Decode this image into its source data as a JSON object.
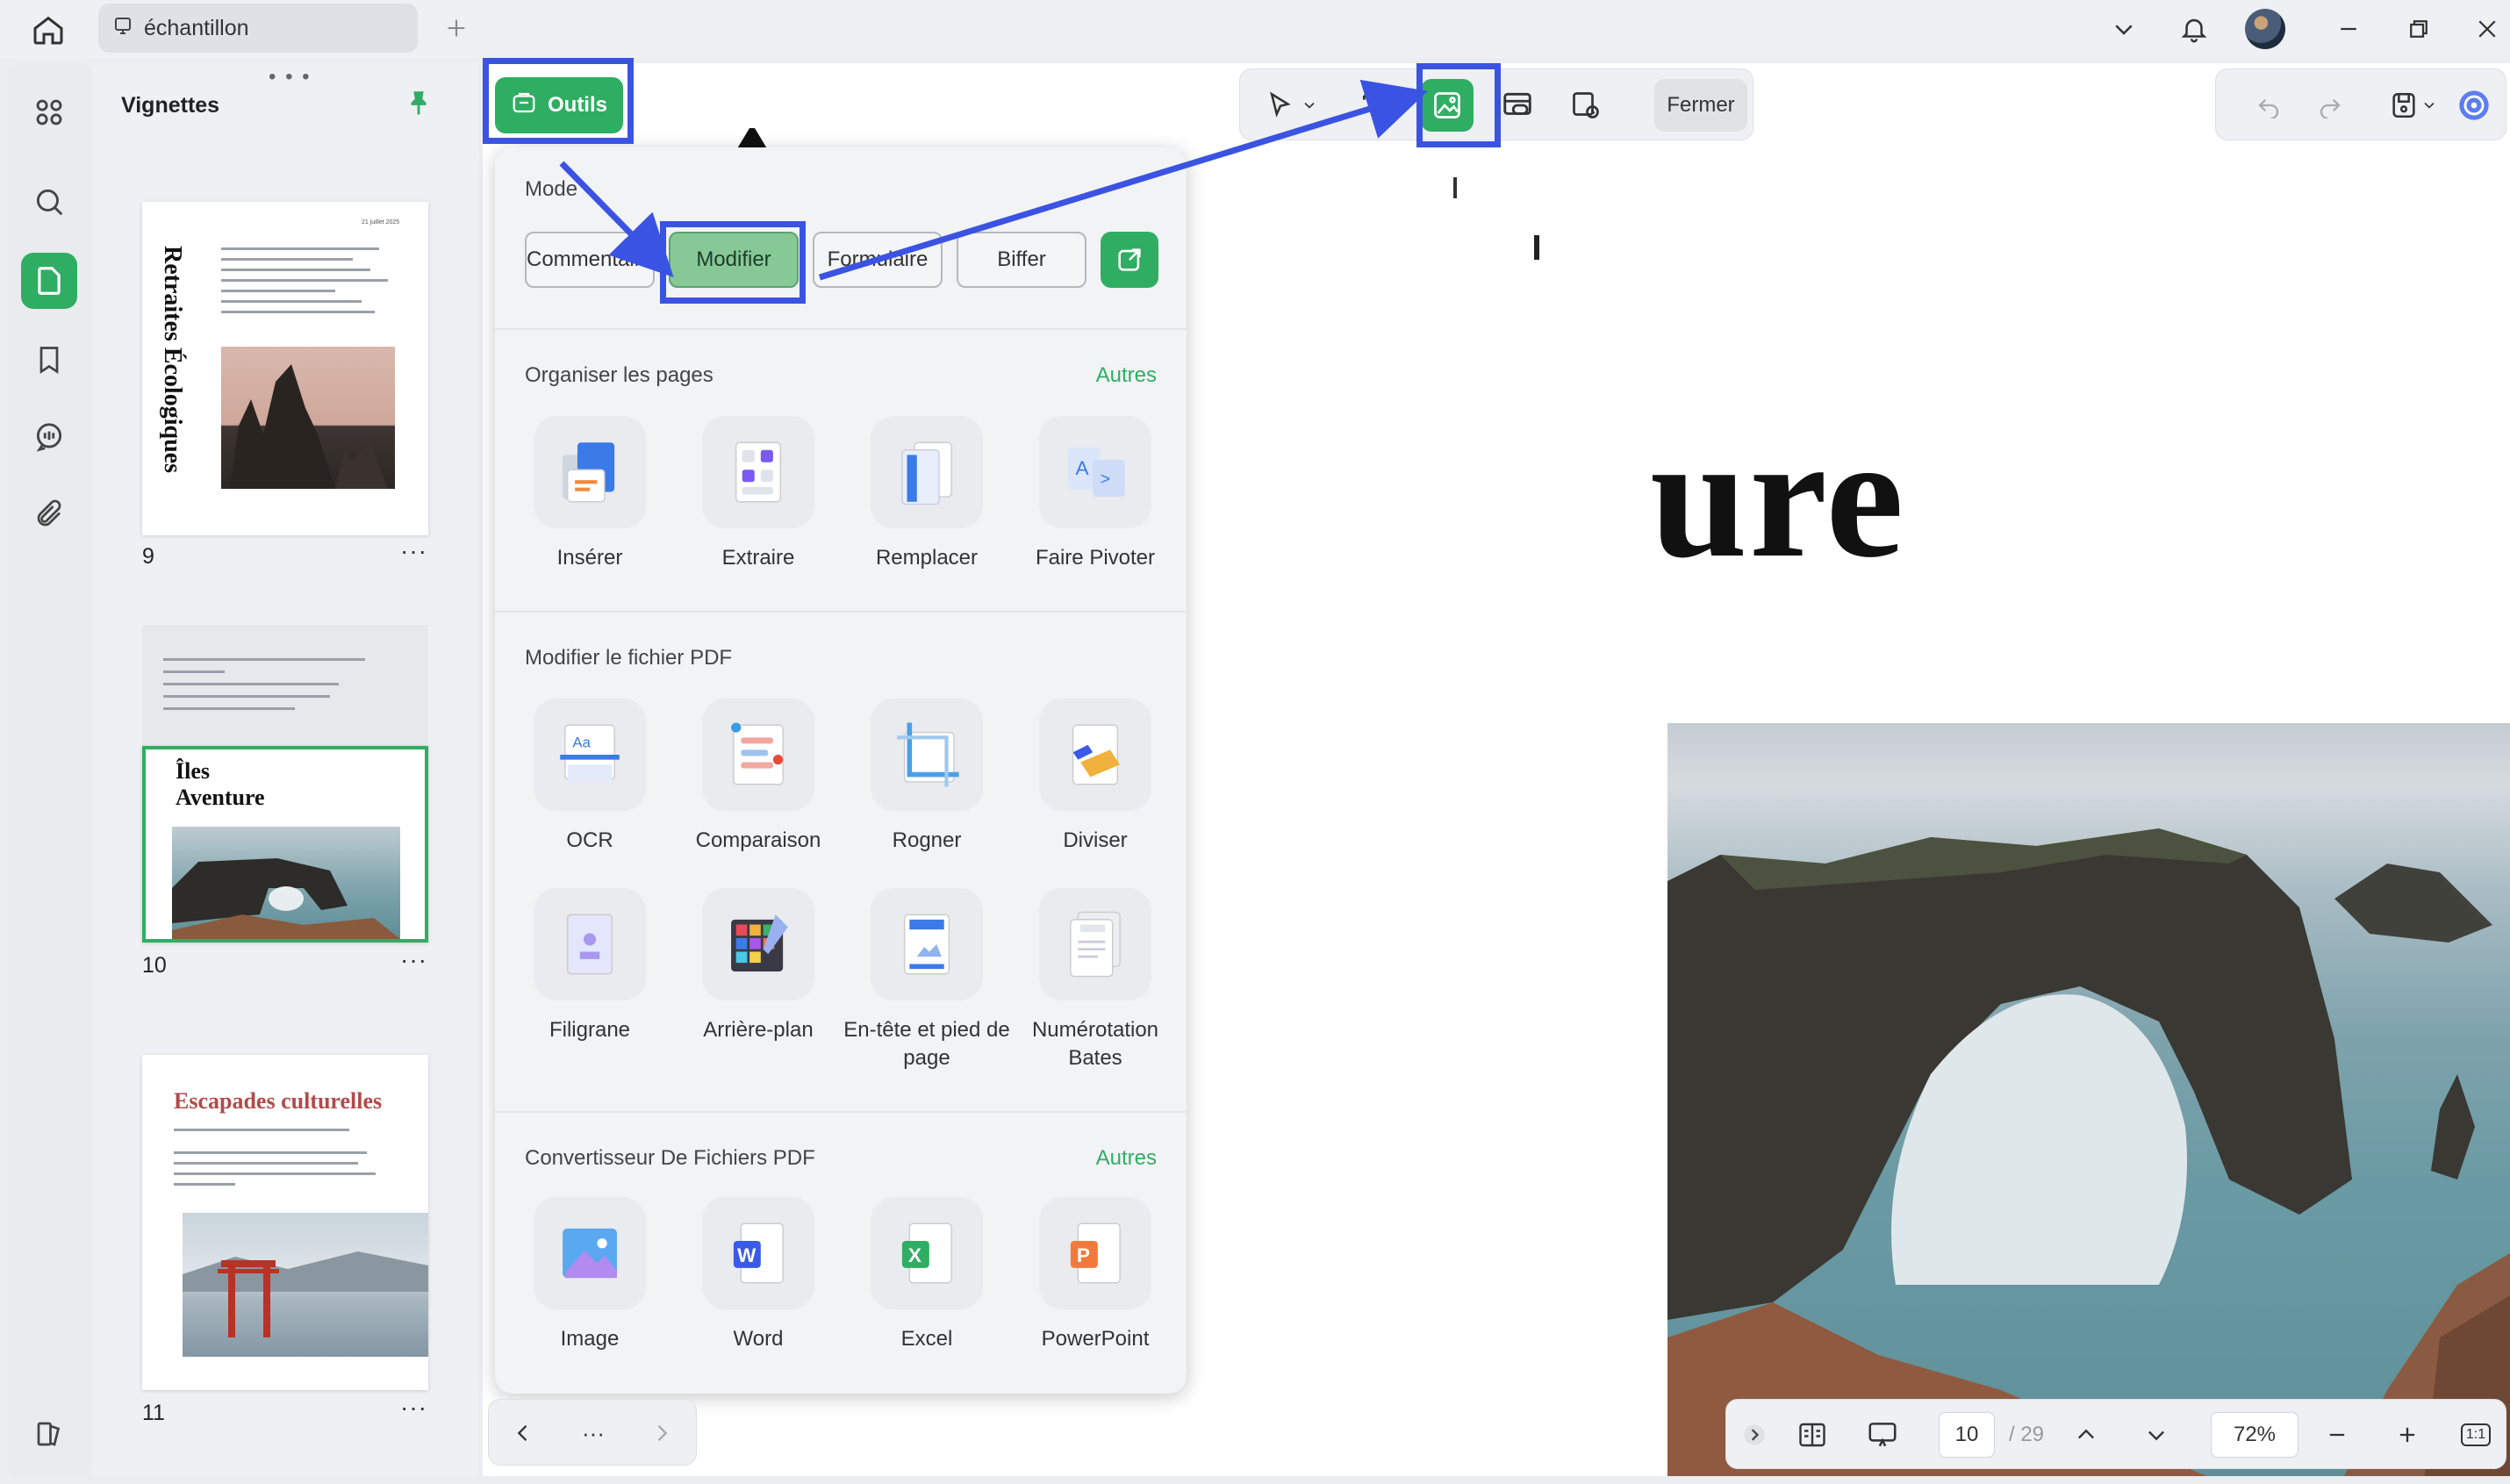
{
  "titlebar": {
    "tab_title": "échantillon"
  },
  "thumbnails": {
    "title": "Vignettes",
    "pages": [
      {
        "number": "9",
        "text": "Retraites Écologiques",
        "date": "21 juillet 2025"
      },
      {
        "number": "10",
        "title_line1": "Îles",
        "title_line2": "Aventure"
      },
      {
        "number": "11",
        "title": "Escapades culturelles"
      }
    ]
  },
  "document": {
    "visible_title": "ure"
  },
  "toolbar": {
    "close_label": "Fermer"
  },
  "tools_button": {
    "label": "Outils"
  },
  "popup": {
    "mode_label": "Mode",
    "modes": [
      "Commentaire",
      "Modifier",
      "Formulaire",
      "Biffer"
    ],
    "active_mode": "Modifier",
    "organize": {
      "label": "Organiser les pages",
      "more": "Autres",
      "items": [
        "Insérer",
        "Extraire",
        "Remplacer",
        "Faire Pivoter"
      ]
    },
    "modify": {
      "label": "Modifier le fichier PDF",
      "items": [
        "OCR",
        "Comparaison",
        "Rogner",
        "Diviser",
        "Filigrane",
        "Arrière-plan",
        "En-tête et pied de page",
        "Numérotation Bates"
      ]
    },
    "convert": {
      "label": "Convertisseur De Fichiers PDF",
      "more": "Autres",
      "items": [
        "Image",
        "Word",
        "Excel",
        "PowerPoint"
      ]
    }
  },
  "pagenav": {
    "more": "···"
  },
  "statusbar": {
    "current_page": "10",
    "total_pages": "/ 29",
    "zoom": "72%",
    "fit_label": "1:1"
  },
  "colors": {
    "accent": "#2fae63",
    "highlight": "#3b53e3"
  }
}
